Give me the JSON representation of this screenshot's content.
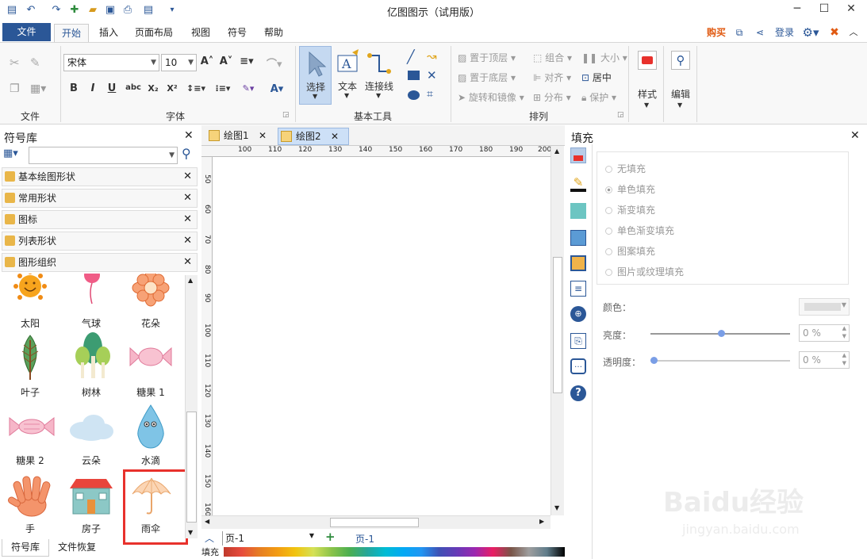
{
  "window": {
    "title": "亿图图示（试用版）"
  },
  "ribbon_tabs": {
    "file": "文件",
    "home": "开始",
    "insert": "插入",
    "page_layout": "页面布局",
    "view": "视图",
    "symbol": "符号",
    "help": "帮助"
  },
  "topright": {
    "buy": "购买",
    "login": "登录"
  },
  "ribbon": {
    "font_name": "宋体",
    "font_size": "10",
    "groups": {
      "file": "文件",
      "font": "字体",
      "basic_tools": "基本工具",
      "arrange": "排列"
    },
    "select": "选择",
    "text": "文本",
    "connector": "连接线",
    "bring_front": "置于顶层",
    "send_back": "置于底层",
    "rotate_mirror": "旋转和镜像",
    "group": "组合",
    "align": "对齐",
    "distribute": "分布",
    "size": "大小",
    "center": "居中",
    "protect": "保护",
    "style": "样式",
    "edit": "编辑"
  },
  "symbol_library": {
    "title": "符号库",
    "search_placeholder": "",
    "libraries": [
      "基本绘图形状",
      "常用形状",
      "图标",
      "列表形状",
      "图形组织"
    ],
    "shapes": [
      "太阳",
      "气球",
      "花朵",
      "叶子",
      "树林",
      "糖果 1",
      "糖果 2",
      "云朵",
      "水滴",
      "手",
      "房子",
      "雨伞"
    ],
    "bottom_tabs": [
      "符号库",
      "文件恢复"
    ]
  },
  "documents": {
    "tabs": [
      "绘图1",
      "绘图2"
    ]
  },
  "ruler": {
    "top": [
      "100",
      "110",
      "120",
      "130",
      "140",
      "150",
      "160",
      "170",
      "180",
      "190",
      "200"
    ],
    "left": [
      "50",
      "60",
      "70",
      "80",
      "90",
      "100",
      "110",
      "120",
      "130",
      "140",
      "150",
      "160"
    ]
  },
  "pages": {
    "current": "页-1",
    "tab": "页-1",
    "fill_label": "填充"
  },
  "fill_panel": {
    "title": "填充",
    "options": [
      "无填充",
      "单色填充",
      "渐变填充",
      "单色渐变填充",
      "图案填充",
      "图片或纹理填充"
    ],
    "selected": "单色填充",
    "color_label": "颜色：",
    "brightness_label": "亮度：",
    "brightness_value": "0 %",
    "transparency_label": "透明度：",
    "transparency_value": "0 %"
  },
  "colors": {
    "accent": "#2b5797",
    "highlight": "#e8312c"
  },
  "watermark": {
    "brand": "Baidu经验",
    "url": "jingyan.baidu.com"
  }
}
